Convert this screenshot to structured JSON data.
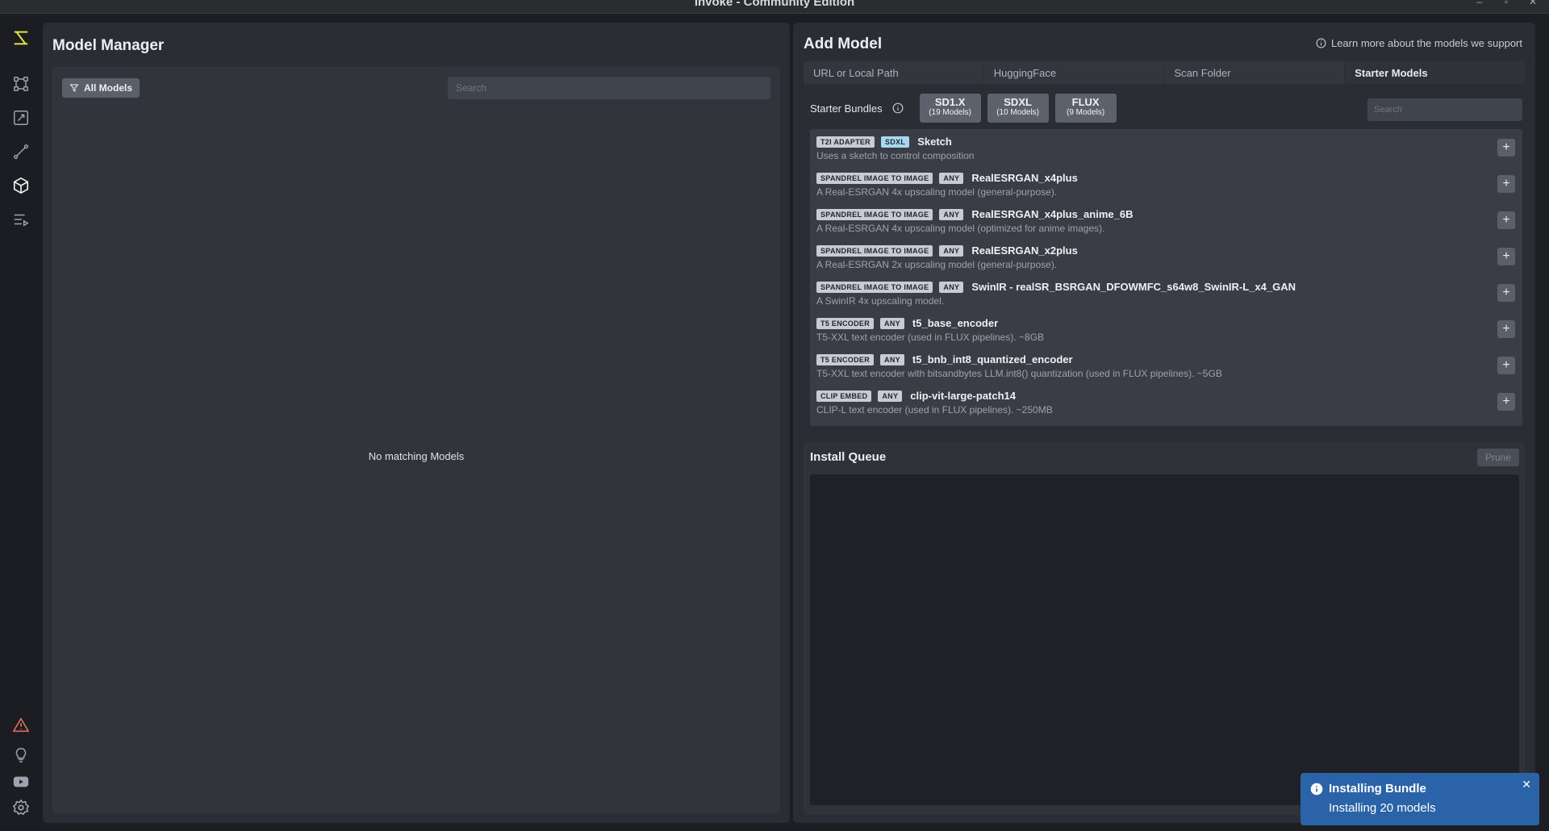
{
  "window": {
    "title": "Invoke - Community Edition"
  },
  "sidebar": {
    "items": [
      {
        "icon": "logo-icon"
      },
      {
        "icon": "workflow-nodes-icon"
      },
      {
        "icon": "canvas-icon"
      },
      {
        "icon": "workflow-edge-icon"
      },
      {
        "icon": "models-cube-icon",
        "active": true
      },
      {
        "icon": "queue-list-icon"
      }
    ],
    "bottom": [
      {
        "icon": "warning-icon",
        "color": "#e06c5a"
      },
      {
        "icon": "lightbulb-icon"
      },
      {
        "icon": "youtube-icon"
      },
      {
        "icon": "settings-gear-icon"
      }
    ]
  },
  "model_manager": {
    "title": "Model Manager",
    "filter_label": "All Models",
    "search_placeholder": "Search",
    "empty_message": "No matching Models"
  },
  "add_model": {
    "title": "Add Model",
    "learn_more": "Learn more about the models we support",
    "tabs": [
      {
        "label": "URL or Local Path"
      },
      {
        "label": "HuggingFace"
      },
      {
        "label": "Scan Folder"
      },
      {
        "label": "Starter Models",
        "active": true
      }
    ],
    "starter_bundles_label": "Starter Bundles",
    "bundles": [
      {
        "name": "SD1.X",
        "count": "(19 Models)"
      },
      {
        "name": "SDXL",
        "count": "(10 Models)"
      },
      {
        "name": "FLUX",
        "count": "(9 Models)"
      }
    ],
    "search_placeholder": "Search",
    "models": [
      {
        "type": "T2I ADAPTER",
        "base": "SDXL",
        "name": "Sketch",
        "desc": "Uses a sketch to control composition"
      },
      {
        "type": "SPANDREL IMAGE TO IMAGE",
        "base": "ANY",
        "name": "RealESRGAN_x4plus",
        "desc": "A Real-ESRGAN 4x upscaling model (general-purpose)."
      },
      {
        "type": "SPANDREL IMAGE TO IMAGE",
        "base": "ANY",
        "name": "RealESRGAN_x4plus_anime_6B",
        "desc": "A Real-ESRGAN 4x upscaling model (optimized for anime images)."
      },
      {
        "type": "SPANDREL IMAGE TO IMAGE",
        "base": "ANY",
        "name": "RealESRGAN_x2plus",
        "desc": "A Real-ESRGAN 2x upscaling model (general-purpose)."
      },
      {
        "type": "SPANDREL IMAGE TO IMAGE",
        "base": "ANY",
        "name": "SwinIR - realSR_BSRGAN_DFOWMFC_s64w8_SwinIR-L_x4_GAN",
        "desc": "A SwinIR 4x upscaling model."
      },
      {
        "type": "T5 ENCODER",
        "base": "ANY",
        "name": "t5_base_encoder",
        "desc": "T5-XXL text encoder (used in FLUX pipelines). ~8GB"
      },
      {
        "type": "T5 ENCODER",
        "base": "ANY",
        "name": "t5_bnb_int8_quantized_encoder",
        "desc": "T5-XXL text encoder with bitsandbytes LLM.int8() quantization (used in FLUX pipelines). ~5GB"
      },
      {
        "type": "CLIP EMBED",
        "base": "ANY",
        "name": "clip-vit-large-patch14",
        "desc": "CLIP-L text encoder (used in FLUX pipelines). ~250MB"
      }
    ],
    "add_label": "+"
  },
  "install_queue": {
    "title": "Install Queue",
    "prune_label": "Prune"
  },
  "toast": {
    "title": "Installing Bundle",
    "message": "Installing 20 models",
    "close": "✕"
  }
}
